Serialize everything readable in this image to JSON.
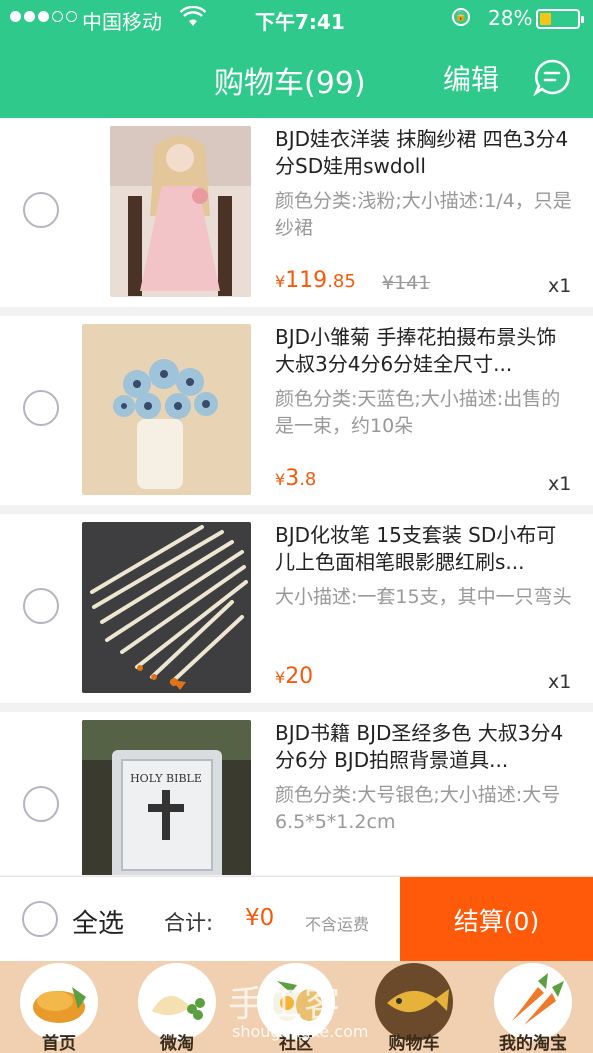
{
  "status_bar": {
    "carrier": "中国移动",
    "time": "下午7:41",
    "battery": "28%",
    "battery_level": 0.28
  },
  "nav": {
    "title": "购物车(99)",
    "edit": "编辑"
  },
  "items": [
    {
      "title": "BJD娃衣洋装 抹胸纱裙 四色3分4分SD娃用swdoll",
      "attr": "颜色分类:浅粉;大小描述:1/4，只是纱裙",
      "currency": "¥",
      "price_int": "119",
      "price_dec": ".85",
      "orig_price": "¥141",
      "qty": "x1"
    },
    {
      "title": "BJD小雏菊 手捧花拍摄布景头饰大叔3分4分6分娃全尺寸...",
      "attr": "颜色分类:天蓝色;大小描述:出售的是一束，约10朵",
      "currency": "¥",
      "price_int": "3",
      "price_dec": ".8",
      "orig_price": "",
      "qty": "x1"
    },
    {
      "title": "BJD化妆笔 15支套装 SD小布可儿上色面相笔眼影腮红刷s...",
      "attr": "大小描述:一套15支，其中一只弯头",
      "currency": "¥",
      "price_int": "20",
      "price_dec": "",
      "orig_price": "",
      "qty": "x1"
    },
    {
      "title": "BJD书籍 BJD圣经多色 大叔3分4分6分 BJD拍照背景道具...",
      "attr": "颜色分类:大号银色;大小描述:大号6.5*5*1.2cm",
      "currency": "",
      "price_int": "",
      "price_dec": "",
      "orig_price": "",
      "qty": ""
    }
  ],
  "checkout": {
    "select_all": "全选",
    "total_label": "合计:",
    "total_value": "¥0",
    "shipping_note": "不含运费",
    "pay_button": "结算(0)"
  },
  "tabs": [
    {
      "label": "首页",
      "icon": "home-food-icon"
    },
    {
      "label": "微淘",
      "icon": "dumpling-icon"
    },
    {
      "label": "社区",
      "icon": "egg-icon"
    },
    {
      "label": "购物车",
      "icon": "fish-icon"
    },
    {
      "label": "我的淘宝",
      "icon": "carrot-icon"
    }
  ],
  "watermark": {
    "main": "手工客",
    "sub": "shougongke.com"
  },
  "colors": {
    "brand_green": "#2fc98b",
    "price_orange": "#f55a0a",
    "pay_orange": "#ff5a0a"
  }
}
